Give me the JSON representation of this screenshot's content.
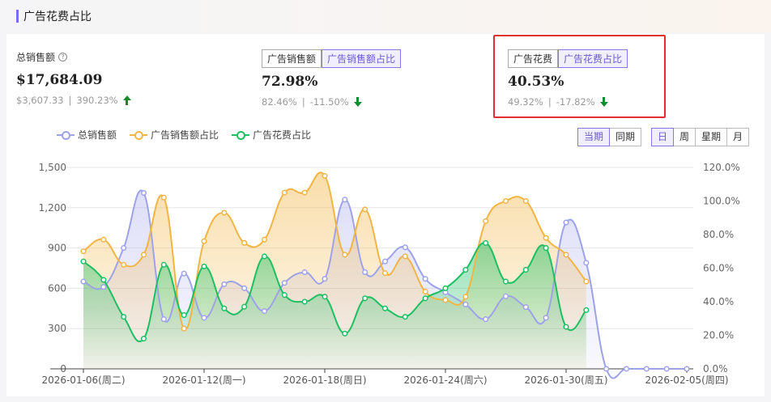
{
  "panel": {
    "title": "广告花费占比"
  },
  "metrics": [
    {
      "label": "总销售额",
      "value": "$17,684.09",
      "prev": "$3,607.33",
      "change": "390.23%",
      "direction": "up"
    },
    {
      "tabs": [
        "广告销售额",
        "广告销售额占比"
      ],
      "active_tab": 1,
      "value": "72.98%",
      "prev": "82.46%",
      "change": "-11.50%",
      "direction": "down"
    },
    {
      "tabs": [
        "广告花费",
        "广告花费占比"
      ],
      "active_tab": 1,
      "value": "40.53%",
      "prev": "49.32%",
      "change": "-17.82%",
      "direction": "down"
    }
  ],
  "separator": "|",
  "period_toggle": {
    "options": [
      "当期",
      "同期"
    ],
    "active": 0
  },
  "granularity_toggle": {
    "options": [
      "日",
      "周",
      "星期",
      "月"
    ],
    "active": 0
  },
  "colors": {
    "sales": "#9ea2e8",
    "ad_sales_ratio": "#f2b544",
    "ad_spend_ratio": "#1dbf63",
    "accent": "#7b6cf6",
    "highlight": "#e03030",
    "positive": "#138a2e"
  },
  "chart_data": {
    "type": "line",
    "x": [
      "2026-01-06(周二)",
      "2026-01-07",
      "2026-01-08",
      "2026-01-09",
      "2026-01-10",
      "2026-01-11",
      "2026-01-12(周一)",
      "2026-01-13",
      "2026-01-14",
      "2026-01-15",
      "2026-01-16",
      "2026-01-17",
      "2026-01-18(周日)",
      "2026-01-19",
      "2026-01-20",
      "2026-01-21",
      "2026-01-22",
      "2026-01-23",
      "2026-01-24(周六)",
      "2026-01-25",
      "2026-01-26",
      "2026-01-27",
      "2026-01-28",
      "2026-01-29",
      "2026-01-30(周五)",
      "2026-01-31",
      "2026-02-01",
      "2026-02-02",
      "2026-02-03",
      "2026-02-04",
      "2026-02-05(周四)"
    ],
    "x_tick_labels": [
      "2026-01-06(周二)",
      "2026-01-12(周一)",
      "2026-01-18(周日)",
      "2026-01-24(周六)",
      "2026-01-30(周五)",
      "2026-02-05(周四)"
    ],
    "y_left": {
      "ticks": [
        "0",
        "300",
        "600",
        "900",
        "1,200",
        "1,500"
      ],
      "ylim": [
        0,
        1500
      ]
    },
    "y_right": {
      "ticks": [
        "0.0%",
        "20.0%",
        "40.0%",
        "60.0%",
        "80.0%",
        "100.0%",
        "120.0%"
      ],
      "ylim": [
        0,
        120
      ]
    },
    "grid": true,
    "legend_position": "top-left",
    "series": [
      {
        "name": "总销售额",
        "axis": "left",
        "values": [
          650,
          610,
          900,
          1310,
          370,
          710,
          380,
          630,
          600,
          430,
          640,
          720,
          670,
          1260,
          720,
          800,
          905,
          670,
          570,
          480,
          370,
          540,
          460,
          380,
          1090,
          790,
          0,
          0,
          0,
          0,
          0
        ]
      },
      {
        "name": "广告销售额占比",
        "axis": "right",
        "values": [
          70,
          77,
          62,
          68,
          102,
          24,
          76,
          93,
          75,
          77,
          105,
          105,
          115,
          68,
          95,
          57,
          67,
          46,
          41,
          43,
          88,
          100,
          100,
          78,
          68,
          52
        ]
      },
      {
        "name": "广告花费占比",
        "axis": "right",
        "values": [
          64,
          53,
          31,
          18,
          62,
          32,
          61,
          36,
          37,
          67,
          44,
          40,
          43,
          21,
          42,
          36,
          31,
          42,
          48,
          59,
          75,
          52,
          59,
          72,
          25,
          35
        ]
      }
    ]
  }
}
